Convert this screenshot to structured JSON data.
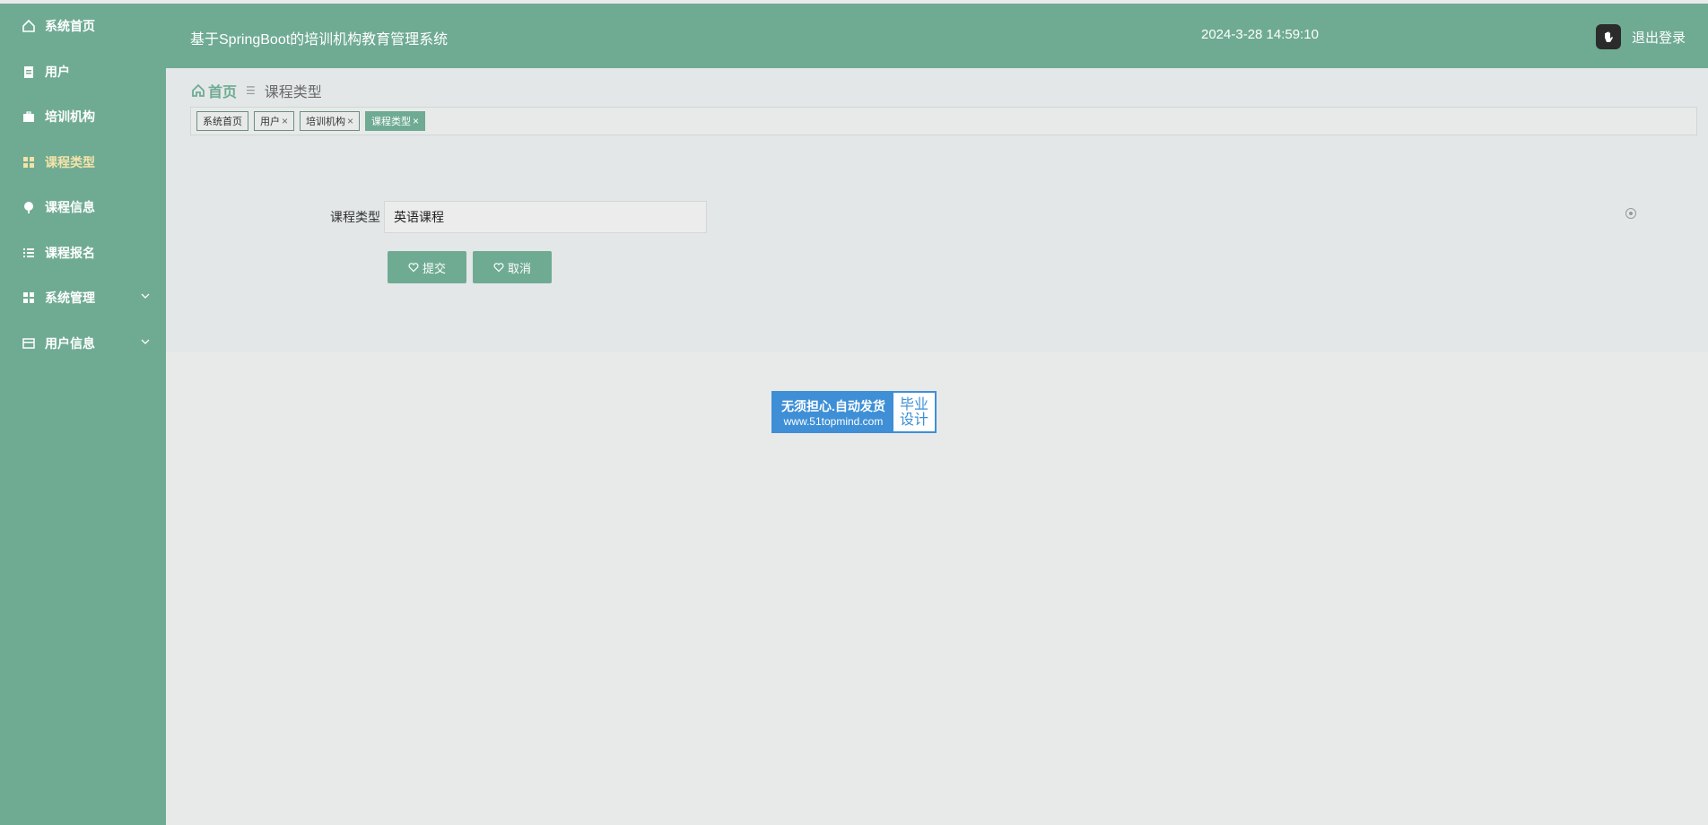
{
  "sidebar": {
    "items": [
      {
        "label": "系统首页",
        "icon": "home-icon"
      },
      {
        "label": "用户",
        "icon": "clipboard-icon"
      },
      {
        "label": "培训机构",
        "icon": "briefcase-icon"
      },
      {
        "label": "课程类型",
        "icon": "grid-icon",
        "active": true
      },
      {
        "label": "课程信息",
        "icon": "location-pin-icon"
      },
      {
        "label": "课程报名",
        "icon": "list-icon"
      },
      {
        "label": "系统管理",
        "icon": "grid-icon",
        "expandable": true
      },
      {
        "label": "用户信息",
        "icon": "card-icon",
        "expandable": true
      }
    ]
  },
  "header": {
    "title": "基于SpringBoot的培训机构教育管理系统",
    "datetime": "2024-3-28 14:59:10",
    "logout_label": "退出登录"
  },
  "breadcrumb": {
    "home": "首页",
    "current": "课程类型"
  },
  "tags": [
    {
      "label": "系统首页",
      "closable": false
    },
    {
      "label": "用户",
      "closable": true
    },
    {
      "label": "培训机构",
      "closable": true
    },
    {
      "label": "课程类型",
      "closable": true,
      "active": true
    }
  ],
  "form": {
    "field_label": "课程类型",
    "field_value": "英语课程",
    "submit_label": "提交",
    "cancel_label": "取消"
  },
  "badge": {
    "line1": "无须担心.自动发货",
    "line2": "www.51topmind.com",
    "right1": "毕业",
    "right2": "设计"
  },
  "colors": {
    "primary": "#6fab93",
    "active_menu_text": "#f3e3a8",
    "badge_blue": "#3e8fd6"
  }
}
